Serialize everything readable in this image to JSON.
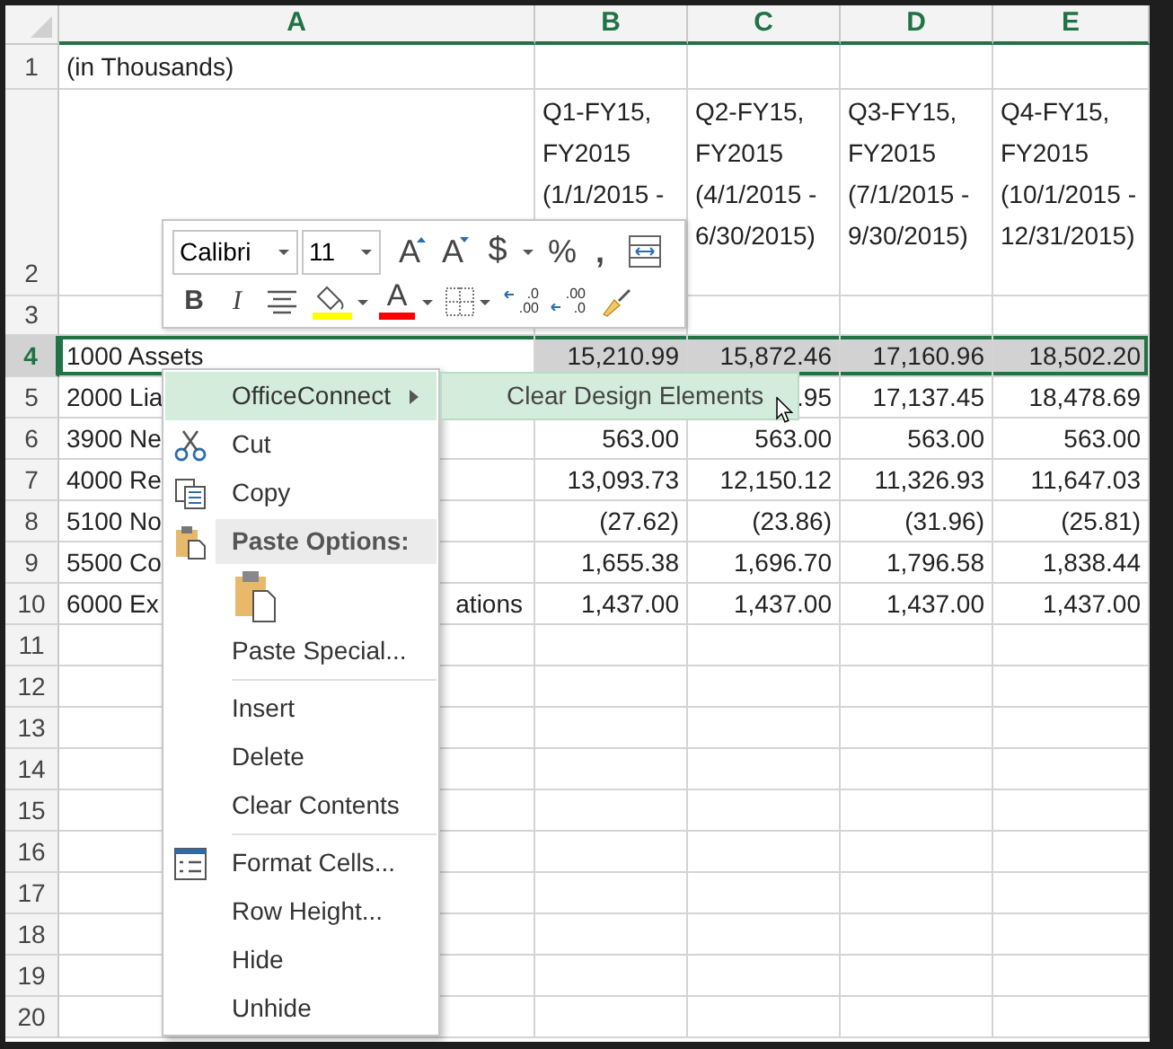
{
  "column_headers": [
    "A",
    "B",
    "C",
    "D",
    "E"
  ],
  "rows": [
    {
      "number": "1",
      "selected": false,
      "a": "(in Thousands)"
    },
    {
      "number": "2",
      "selected": false,
      "headers": [
        [
          "Q1-FY15,",
          "FY2015",
          "(1/1/2015 -"
        ],
        [
          "Q2-FY15,",
          "FY2015",
          "(4/1/2015 -",
          "6/30/2015)"
        ],
        [
          "Q3-FY15,",
          "FY2015",
          "(7/1/2015 -",
          "9/30/2015)"
        ],
        [
          "Q4-FY15,",
          "FY2015",
          "(10/1/2015 -",
          "12/31/2015)"
        ]
      ]
    },
    {
      "number": "3",
      "selected": false
    },
    {
      "number": "4",
      "selected": true,
      "a": "1000 Assets",
      "values": [
        "15,210.99",
        "15,872.46",
        "17,160.96",
        "18,502.20"
      ]
    },
    {
      "number": "5",
      "selected": false,
      "a": "2000 Lia",
      "values_cde": [
        ".95",
        "17,137.45",
        "18,478.69"
      ]
    },
    {
      "number": "6",
      "selected": false,
      "a": "3900 Ne",
      "values": [
        "563.00",
        "563.00",
        "563.00",
        "563.00"
      ]
    },
    {
      "number": "7",
      "selected": false,
      "a": "4000 Re",
      "values": [
        "13,093.73",
        "12,150.12",
        "11,326.93",
        "11,647.03"
      ]
    },
    {
      "number": "8",
      "selected": false,
      "a": "5100 No",
      "values": [
        "(27.62)",
        "(23.86)",
        "(31.96)",
        "(25.81)"
      ]
    },
    {
      "number": "9",
      "selected": false,
      "a": "5500 Co",
      "values": [
        "1,655.38",
        "1,696.70",
        "1,796.58",
        "1,838.44"
      ]
    },
    {
      "number": "10",
      "selected": false,
      "a": "6000 Ex",
      "a_tail": "ations",
      "values": [
        "1,437.00",
        "1,437.00",
        "1,437.00",
        "1,437.00"
      ]
    },
    {
      "number": "11",
      "selected": false
    },
    {
      "number": "12",
      "selected": false
    },
    {
      "number": "13",
      "selected": false
    },
    {
      "number": "14",
      "selected": false
    },
    {
      "number": "15",
      "selected": false
    },
    {
      "number": "16",
      "selected": false
    },
    {
      "number": "17",
      "selected": false
    },
    {
      "number": "18",
      "selected": false
    },
    {
      "number": "19",
      "selected": false
    },
    {
      "number": "20",
      "selected": false
    }
  ],
  "mini_toolbar": {
    "top_row": [
      {
        "kind": "fontbox",
        "text": "Calibri"
      },
      {
        "kind": "sizebox",
        "text": "11"
      },
      {
        "kind": "grow",
        "text": "A"
      },
      {
        "kind": "shrink",
        "text": "A"
      },
      {
        "kind": "currency",
        "text": "$"
      },
      {
        "kind": "dropdown"
      },
      {
        "kind": "percent",
        "text": "%"
      },
      {
        "kind": "comma",
        "text": ","
      },
      {
        "kind": "wrap"
      }
    ],
    "bottom_row": [
      {
        "kind": "bold",
        "text": "B"
      },
      {
        "kind": "italic",
        "text": "I"
      },
      {
        "kind": "center"
      },
      {
        "kind": "fill"
      },
      {
        "kind": "dropdown"
      },
      {
        "kind": "fontcolor",
        "text": "A"
      },
      {
        "kind": "dropdown"
      },
      {
        "kind": "borders"
      },
      {
        "kind": "dropdown"
      },
      {
        "kind": "incdecimal",
        "top": ".0",
        "bottom": ".00"
      },
      {
        "kind": "decdecimal",
        "top": ".00",
        "bottom": ".0"
      },
      {
        "kind": "painter"
      }
    ]
  },
  "context_menu": {
    "items": [
      {
        "kind": "submenu",
        "label": "OfficeConnect",
        "selected": true
      },
      {
        "kind": "cut",
        "label": "Cut",
        "selected": false
      },
      {
        "kind": "copy",
        "label": "Copy",
        "selected": false
      },
      {
        "kind": "pasteheader",
        "label": "Paste Options:"
      },
      {
        "kind": "pastebutton",
        "selected": false
      },
      {
        "kind": "plain",
        "label": "Paste Special...",
        "selected": false
      },
      {
        "kind": "separator"
      },
      {
        "kind": "plain",
        "label": "Insert",
        "selected": false
      },
      {
        "kind": "plain",
        "label": "Delete",
        "selected": false
      },
      {
        "kind": "plain",
        "label": "Clear Contents",
        "selected": false
      },
      {
        "kind": "separator"
      },
      {
        "kind": "format",
        "label": "Format Cells...",
        "selected": false
      },
      {
        "kind": "plain",
        "label": "Row Height...",
        "selected": false
      },
      {
        "kind": "plain",
        "label": "Hide",
        "selected": false
      },
      {
        "kind": "plain",
        "label": "Unhide",
        "selected": false
      }
    ]
  },
  "submenu": {
    "items": [
      {
        "label": "Clear Design Elements",
        "selected": true
      }
    ]
  }
}
